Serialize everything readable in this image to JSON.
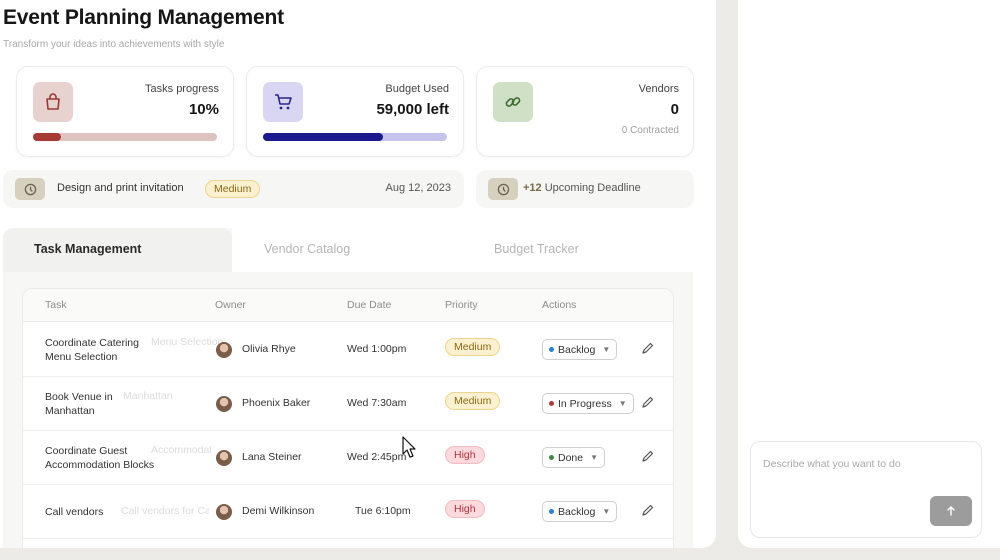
{
  "header": {
    "title": "Event Planning Management",
    "subtitle": "Transform your ideas into achievements with style"
  },
  "cards": {
    "tasks": {
      "label": "Tasks progress",
      "value": "10%",
      "progress": 0.15,
      "icon": "shopping-bag-icon",
      "accent": "#a63a35",
      "track": "#ddc4c0",
      "icon_bg": "#e8d2cf"
    },
    "budget": {
      "label": "Budget Used",
      "value": "59,000 left",
      "progress": 0.65,
      "icon": "cart-icon",
      "accent": "#1c1a8c",
      "track": "#c6c4ec",
      "icon_bg": "#d8d6f3"
    },
    "vendors": {
      "label": "Vendors",
      "value": "0",
      "note": "0 Contracted",
      "icon": "link-icon",
      "icon_bg": "#cfe0c6"
    }
  },
  "upcoming_task": {
    "name": "Design and print invitation",
    "priority": "Medium",
    "date": "Aug 12, 2023",
    "icon": "clock-icon"
  },
  "deadline": {
    "count": "+12",
    "label": "Upcoming Deadline",
    "icon": "clock-icon"
  },
  "tabs": [
    {
      "label": "Task Management",
      "active": true
    },
    {
      "label": "Vendor Catalog",
      "active": false
    },
    {
      "label": "Budget Tracker",
      "active": false
    }
  ],
  "table": {
    "headers": [
      "Task",
      "Owner",
      "Due Date",
      "Priority",
      "Actions"
    ],
    "rows": [
      {
        "task_line1": "Coordinate Catering",
        "task_line2": "Menu Selection",
        "ghost": "Menu Selection",
        "owner": "Olivia Rhye",
        "due": "Wed 1:00pm",
        "priority": "Medium",
        "status": "Backlog",
        "status_color": "#2d7fd3"
      },
      {
        "task_line1": "Book Venue in",
        "task_line2": "Manhattan",
        "ghost": "Manhattan",
        "owner": "Phoenix Baker",
        "due": "Wed 7:30am",
        "priority": "Medium",
        "status": "In Progress",
        "status_color": "#b13a3a"
      },
      {
        "task_line1": "Coordinate Guest",
        "task_line2": "Accommodation Blocks",
        "ghost": "Accommodation Blocks",
        "owner": "Lana Steiner",
        "due": "Wed 2:45pm",
        "priority": "High",
        "status": "Done",
        "status_color": "#3d8a3d"
      },
      {
        "task_line1": "Call vendors",
        "task_line2": "",
        "ghost": "Call vendors for Catering Pricing",
        "owner": "Demi Wilkinson",
        "due": "Tue 6:10pm",
        "priority": "High",
        "status": "Backlog",
        "status_color": "#2d7fd3"
      }
    ]
  },
  "chat": {
    "placeholder": "Describe what you want to do",
    "send_icon": "arrow-up-icon"
  }
}
